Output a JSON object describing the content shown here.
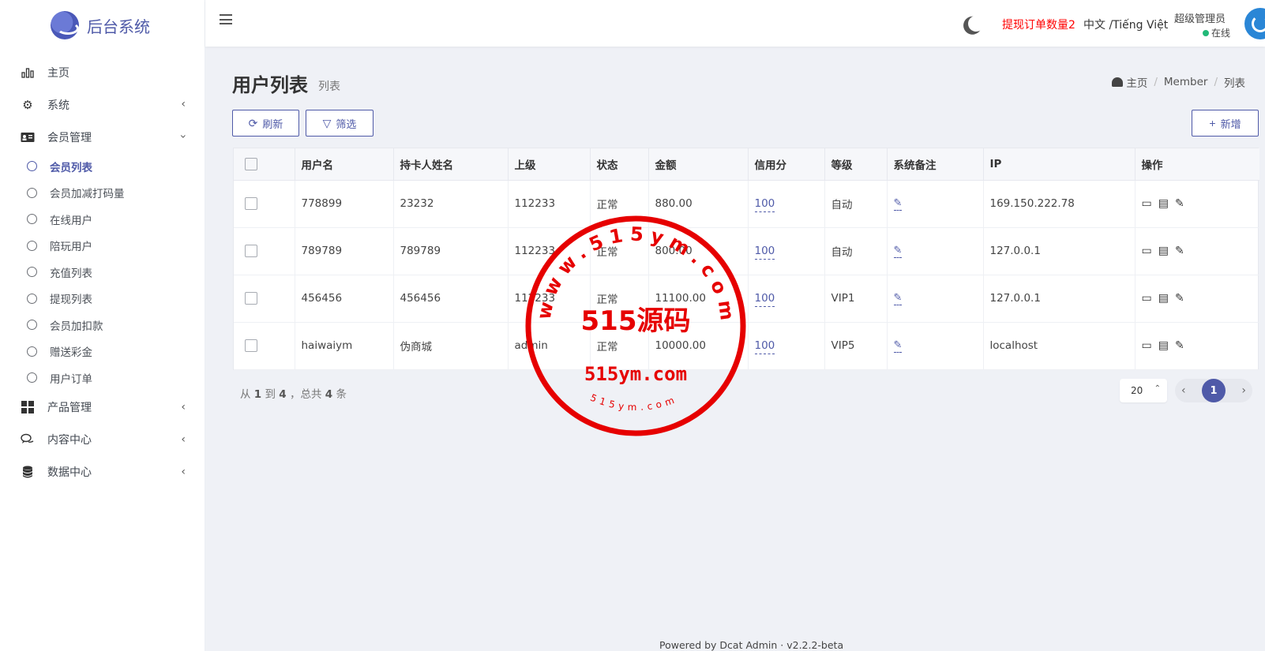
{
  "brand": {
    "title": "后台系统"
  },
  "sidebar": {
    "items": [
      {
        "label": "主页",
        "icon": "bar-chart-icon"
      },
      {
        "label": "系统",
        "icon": "gear-icon"
      },
      {
        "label": "会员管理",
        "icon": "id-card-icon"
      }
    ],
    "member_sub": [
      {
        "label": "会员列表",
        "active": true
      },
      {
        "label": "会员加减打码量"
      },
      {
        "label": "在线用户"
      },
      {
        "label": "陪玩用户"
      },
      {
        "label": "充值列表"
      },
      {
        "label": "提现列表"
      },
      {
        "label": "会员加扣款"
      },
      {
        "label": "赠送彩金"
      },
      {
        "label": "用户订单"
      }
    ],
    "bottom_items": [
      {
        "label": "产品管理",
        "icon": "grid-icon"
      },
      {
        "label": "内容中心",
        "icon": "chat-icon"
      },
      {
        "label": "数据中心",
        "icon": "database-icon"
      }
    ]
  },
  "navbar": {
    "withdraw_notice": "提现订单数量2",
    "language": "中文 /Tiếng Việt",
    "user_name": "超级管理员",
    "user_status": "在线",
    "status_color": "#21b978"
  },
  "page": {
    "title": "用户列表",
    "subtitle": "列表",
    "breadcrumb": [
      "主页",
      "Member",
      "列表"
    ]
  },
  "toolbar": {
    "refresh_label": "刷新",
    "filter_label": "筛选",
    "add_label": "新增"
  },
  "table": {
    "headers": [
      "用户名",
      "持卡人姓名",
      "上级",
      "状态",
      "金额",
      "信用分",
      "等级",
      "系统备注",
      "IP",
      "操作"
    ],
    "rows": [
      {
        "username": "778899",
        "holder": "23232",
        "parent": "112233",
        "status": "正常",
        "amount": "880.00",
        "credit": "100",
        "level": "自动",
        "ip": "169.150.222.78"
      },
      {
        "username": "789789",
        "holder": "789789",
        "parent": "112233",
        "status": "正常",
        "amount": "800.00",
        "credit": "100",
        "level": "自动",
        "ip": "127.0.0.1"
      },
      {
        "username": "456456",
        "holder": "456456",
        "parent": "112233",
        "status": "正常",
        "amount": "11100.00",
        "credit": "100",
        "level": "VIP1",
        "ip": "127.0.0.1"
      },
      {
        "username": "haiwaiym",
        "holder": "伪商城",
        "parent": "admin",
        "status": "正常",
        "amount": "10000.00",
        "credit": "100",
        "level": "VIP5",
        "ip": "localhost"
      }
    ]
  },
  "pagination": {
    "summary_from": "从",
    "from": "1",
    "summary_to": "到",
    "to": "4",
    "summary_total": "，总共",
    "total": "4",
    "summary_unit": "条",
    "per_page": "20",
    "current_page": "1"
  },
  "watermark": {
    "ring_text": "www.515ym.com",
    "center_text": "515源码",
    "domain_text": "515ym.com",
    "bottom_text": "515ym.com",
    "color": "#e60000"
  },
  "footer": {
    "text": "Powered by Dcat Admin · v2.2.2-beta"
  },
  "colors": {
    "accent": "#4f5aa8",
    "alert": "#ff0000"
  }
}
